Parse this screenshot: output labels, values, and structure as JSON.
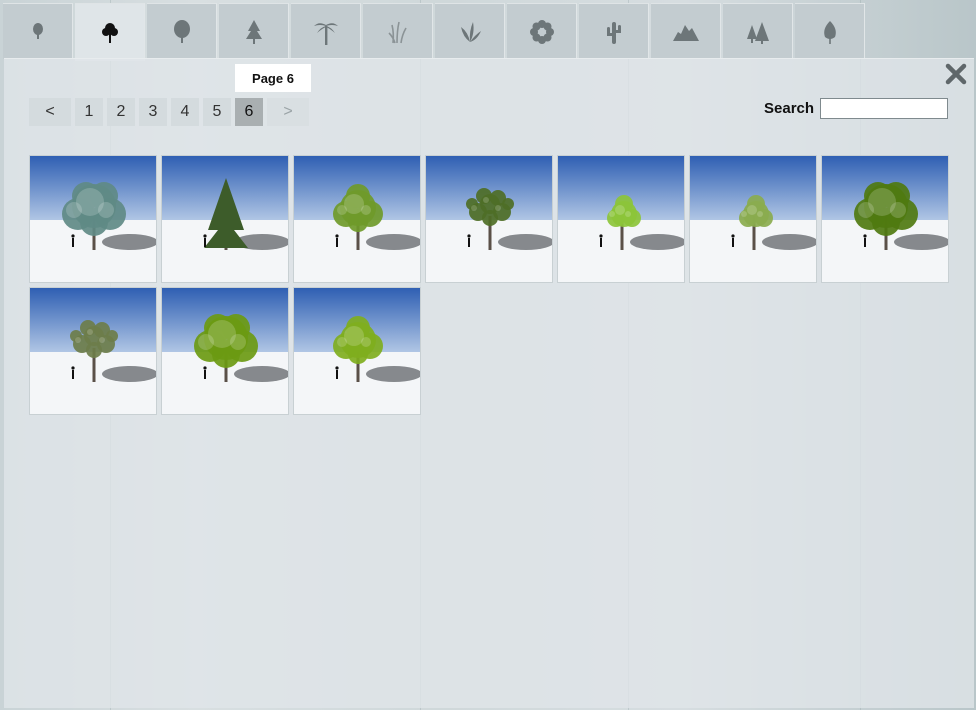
{
  "tabs": [
    {
      "id": "small-tree",
      "icon": "small-tree-icon",
      "active": false
    },
    {
      "id": "deciduous",
      "icon": "deciduous-tree-icon",
      "active": true
    },
    {
      "id": "round-tree",
      "icon": "round-tree-icon",
      "active": false
    },
    {
      "id": "conifer",
      "icon": "conifer-icon",
      "active": false
    },
    {
      "id": "palm",
      "icon": "palm-tree-icon",
      "active": false
    },
    {
      "id": "grass",
      "icon": "grass-icon",
      "active": false
    },
    {
      "id": "plant",
      "icon": "plant-icon",
      "active": false
    },
    {
      "id": "flower",
      "icon": "flower-icon",
      "active": false
    },
    {
      "id": "cactus",
      "icon": "cactus-icon",
      "active": false
    },
    {
      "id": "rock",
      "icon": "rock-icon",
      "active": false
    },
    {
      "id": "forest",
      "icon": "forest-icon",
      "active": false
    },
    {
      "id": "leaf",
      "icon": "leaf-icon",
      "active": false
    }
  ],
  "page_tooltip": "Page 6",
  "pagination": {
    "prev_label": "<",
    "next_label": ">",
    "pages": [
      "1",
      "2",
      "3",
      "4",
      "5",
      "6"
    ],
    "current": "6"
  },
  "search": {
    "label": "Search",
    "value": "",
    "placeholder": ""
  },
  "thumbnails": [
    {
      "name": "tree-1",
      "foliage": "#5f8a86",
      "shape": "wide"
    },
    {
      "name": "tree-2",
      "foliage": "#3d5c2a",
      "shape": "conifer"
    },
    {
      "name": "tree-3",
      "foliage": "#6f9a2a",
      "shape": "round"
    },
    {
      "name": "tree-4",
      "foliage": "#4e6e26",
      "shape": "sparse"
    },
    {
      "name": "tree-5",
      "foliage": "#8cc43a",
      "shape": "small"
    },
    {
      "name": "tree-6",
      "foliage": "#8aab4e",
      "shape": "small"
    },
    {
      "name": "tree-7",
      "foliage": "#4f7a10",
      "shape": "wide"
    },
    {
      "name": "tree-8",
      "foliage": "#6c7d4a",
      "shape": "sparse"
    },
    {
      "name": "tree-9",
      "foliage": "#6b9a12",
      "shape": "wide"
    },
    {
      "name": "tree-10",
      "foliage": "#7fae1e",
      "shape": "round"
    }
  ]
}
